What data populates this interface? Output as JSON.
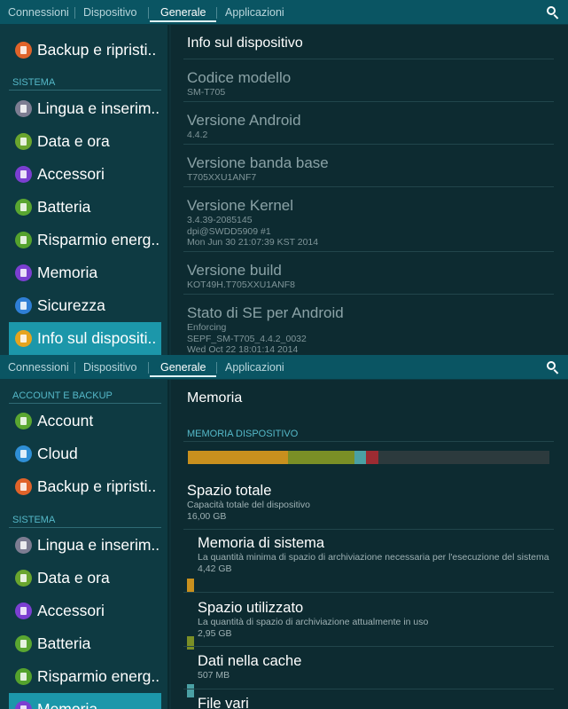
{
  "tabs": [
    "Connessioni",
    "Dispositivo",
    "Generale",
    "Applicazioni"
  ],
  "active_tab": "Generale",
  "icons": {
    "search": "search-icon"
  },
  "screen1": {
    "sidebar": {
      "top_item": {
        "label": "Backup e ripristi..",
        "icon": "backup-icon",
        "color": "#e0632a"
      },
      "section": "SISTEMA",
      "items": [
        {
          "label": "Lingua e inserim..",
          "icon": "language-icon",
          "color": "#7d7d92"
        },
        {
          "label": "Data e ora",
          "icon": "calendar-icon",
          "color": "#6aa52e"
        },
        {
          "label": "Accessori",
          "icon": "accessories-icon",
          "color": "#7b3fd1"
        },
        {
          "label": "Batteria",
          "icon": "battery-icon",
          "color": "#5aa631"
        },
        {
          "label": "Risparmio energ..",
          "icon": "power-saving-icon",
          "color": "#55a22d"
        },
        {
          "label": "Memoria",
          "icon": "memory-icon",
          "color": "#7b3fd1"
        },
        {
          "label": "Sicurezza",
          "icon": "lock-icon",
          "color": "#2f7fd6"
        },
        {
          "label": "Info sul dispositi..",
          "icon": "info-icon",
          "color": "#e6a41e"
        }
      ]
    },
    "content": {
      "title": "Info sul dispositivo",
      "rows": [
        {
          "key": "Codice modello",
          "value": "SM-T705"
        },
        {
          "key": "Versione Android",
          "value": "4.4.2"
        },
        {
          "key": "Versione banda base",
          "value": "T705XXU1ANF7"
        },
        {
          "key": "Versione Kernel",
          "value": "3.4.39-2085145\ndpi@SWDD5909 #1\nMon Jun 30 21:07:39 KST 2014"
        },
        {
          "key": "Versione build",
          "value": "KOT49H.T705XXU1ANF8"
        },
        {
          "key": "Stato di SE per Android",
          "value": "Enforcing\nSEPF_SM-T705_4.4.2_0032\nWed Oct 22 18:01:14 2014"
        }
      ]
    }
  },
  "screen2": {
    "sidebar": {
      "section1": "ACCOUNT E BACKUP",
      "items1": [
        {
          "label": "Account",
          "icon": "key-icon",
          "color": "#5aa631"
        },
        {
          "label": "Cloud",
          "icon": "cloud-icon",
          "color": "#2f8fd6"
        },
        {
          "label": "Backup e ripristi..",
          "icon": "backup-icon",
          "color": "#e0632a"
        }
      ],
      "section2": "SISTEMA",
      "items2": [
        {
          "label": "Lingua e inserim..",
          "icon": "language-icon",
          "color": "#7d7d92"
        },
        {
          "label": "Data e ora",
          "icon": "calendar-icon",
          "color": "#6aa52e"
        },
        {
          "label": "Accessori",
          "icon": "accessories-icon",
          "color": "#7b3fd1"
        },
        {
          "label": "Batteria",
          "icon": "battery-icon",
          "color": "#5aa631"
        },
        {
          "label": "Risparmio energ..",
          "icon": "power-saving-icon",
          "color": "#55a22d"
        },
        {
          "label": "Memoria",
          "icon": "memory-icon",
          "color": "#7b3fd1"
        }
      ]
    },
    "content": {
      "title": "Memoria",
      "section": "MEMORIA DISPOSITIVO",
      "usage_bar": [
        {
          "name": "Memoria di sistema",
          "fraction": 0.276,
          "color": "#c8901e"
        },
        {
          "name": "Spazio utilizzato",
          "fraction": 0.184,
          "color": "#7a8f26"
        },
        {
          "name": "Dati nella cache",
          "fraction": 0.032,
          "color": "#4aa0a4"
        },
        {
          "name": "File vari",
          "fraction": 0.034,
          "color": "#9c2b32"
        }
      ],
      "total": {
        "key": "Spazio totale",
        "desc": "Capacità totale del dispositivo",
        "value": "16,00 GB"
      },
      "rows": [
        {
          "key": "Memoria di sistema",
          "desc": "La quantità minima di spazio di archiviazione necessaria per l'esecuzione del sistema",
          "value": "4,42 GB",
          "color": "#c8901e"
        },
        {
          "key": "Spazio utilizzato",
          "desc": "La quantità di spazio di archiviazione attualmente in uso",
          "value": "2,95 GB",
          "color": "#7a8f26"
        },
        {
          "key": "Dati nella cache",
          "desc": "",
          "value": "507 MB",
          "color": "#4aa0a4"
        },
        {
          "key": "File vari",
          "desc": "",
          "value": "",
          "color": "#9c2b32"
        }
      ]
    }
  }
}
